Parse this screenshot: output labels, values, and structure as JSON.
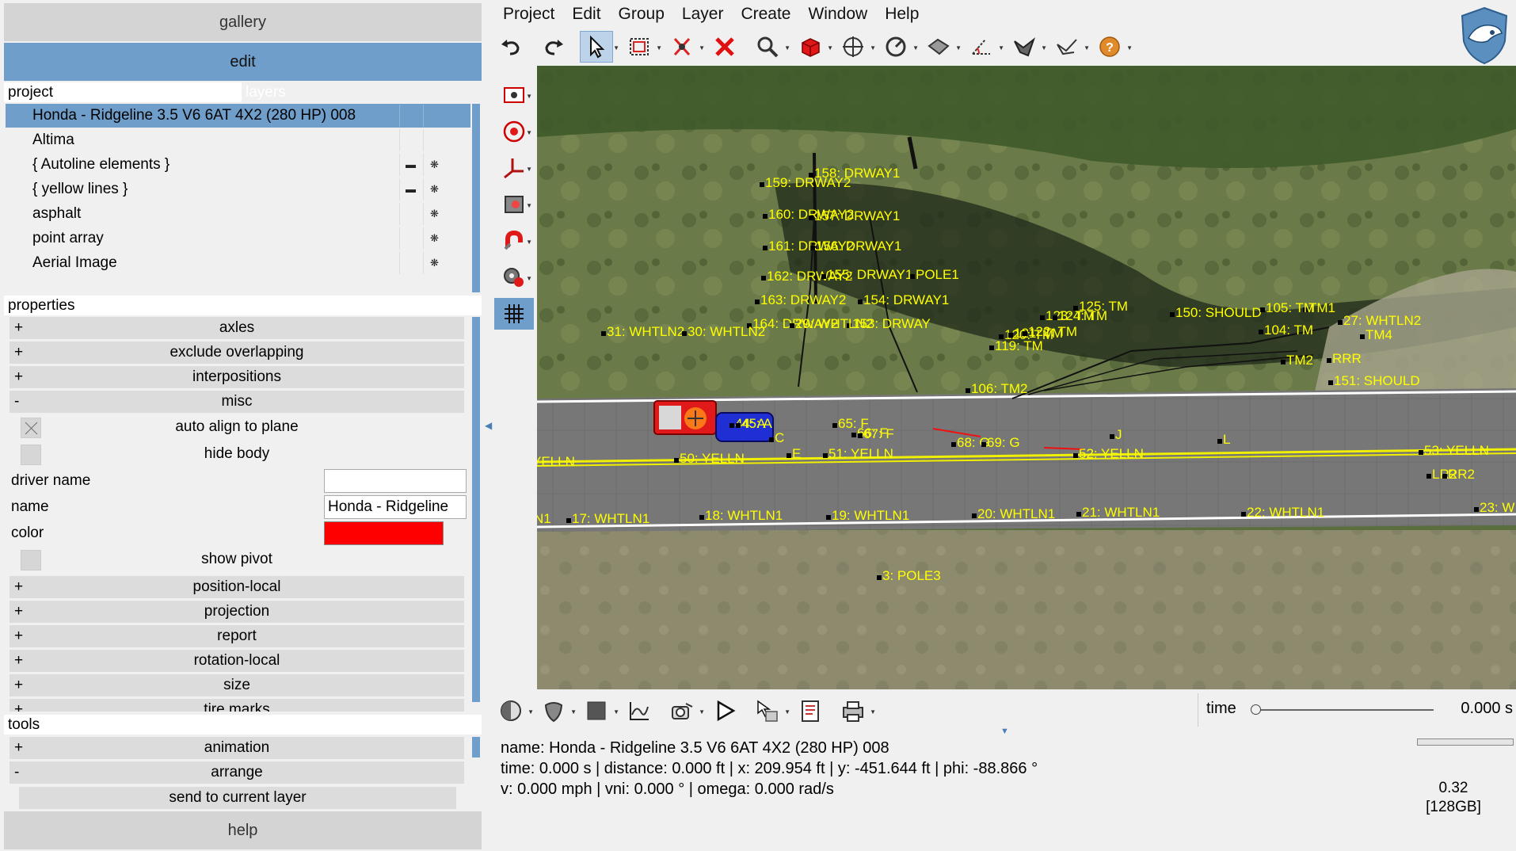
{
  "left_panel": {
    "gallery_label": "gallery",
    "edit_label": "edit",
    "tabs": {
      "project": "project",
      "layers": "layers"
    },
    "layers": [
      {
        "name": "Honda - Ridgeline 3.5 V6 6AT 4X2 (280 HP) 008",
        "selected": true,
        "c1": "",
        "c2": ""
      },
      {
        "name": "Altima",
        "selected": false,
        "c1": "",
        "c2": ""
      },
      {
        "name": "{ Autoline elements }",
        "selected": false,
        "c1": "▬",
        "c2": "❋"
      },
      {
        "name": "{ yellow lines }",
        "selected": false,
        "c1": "▬",
        "c2": "❋"
      },
      {
        "name": "asphalt",
        "selected": false,
        "c1": "",
        "c2": "❋"
      },
      {
        "name": "point array",
        "selected": false,
        "c1": "",
        "c2": "❋"
      },
      {
        "name": "Aerial Image",
        "selected": false,
        "c1": "",
        "c2": "❋"
      }
    ],
    "properties_header": "properties",
    "properties": {
      "axles": {
        "sign": "+",
        "label": "axles"
      },
      "exclude_overlapping": {
        "sign": "+",
        "label": "exclude overlapping"
      },
      "interpositions": {
        "sign": "+",
        "label": "interpositions"
      },
      "misc": {
        "sign": "-",
        "label": "misc"
      },
      "auto_align": "auto align to plane",
      "hide_body": "hide body",
      "driver_name_label": "driver name",
      "driver_name_value": "",
      "name_label": "name",
      "name_value": "Honda - Ridgeline",
      "color_label": "color",
      "color_value": "#ff0000",
      "show_pivot": "show pivot",
      "position_local": {
        "sign": "+",
        "label": "position-local"
      },
      "projection": {
        "sign": "+",
        "label": "projection"
      },
      "report": {
        "sign": "+",
        "label": "report"
      },
      "rotation_local": {
        "sign": "+",
        "label": "rotation-local"
      },
      "size": {
        "sign": "+",
        "label": "size"
      },
      "tire_marks": {
        "sign": "+",
        "label": "tire marks"
      }
    },
    "tools_header": "tools",
    "tools": {
      "animation": {
        "sign": "+",
        "label": "animation"
      },
      "arrange": {
        "sign": "-",
        "label": "arrange"
      },
      "send_label": "send to current layer"
    },
    "help_label": "help"
  },
  "menubar": [
    "Project",
    "Edit",
    "Group",
    "Layer",
    "Create",
    "Window",
    "Help"
  ],
  "toolbar_icons": [
    "undo-icon",
    "redo-icon",
    "select-arrow-icon",
    "box-select-icon",
    "cut-point-icon",
    "delete-icon",
    "zoom-icon",
    "cube-icon",
    "pan-crosshair-icon",
    "measure-dial-icon",
    "plane-icon",
    "angle-measure-icon",
    "terrain-icon",
    "surface-icon",
    "help-icon"
  ],
  "side_tools": [
    "camera-record-icon",
    "target-icon",
    "axis-icon",
    "screenshot-icon",
    "magnet-icon",
    "settings-icon",
    "grid-icon"
  ],
  "viewport_labels": [
    "158: DRWAY1",
    "159: DRWAY2",
    "160: DRWAY2",
    "157: DRWAY1",
    "161: DRWAY2",
    "156: DRWAY1",
    "162: DRWAY2",
    "155: DRWAY1",
    "POLE1",
    "163: DRWAY2",
    "154: DRWAY1",
    "164: DRWAY2",
    "153: DRWAY",
    "31: WHTLN2",
    "30: WHTLN2",
    "29: WHTLN2",
    "150: SHOULD",
    "27: WHTLN2",
    "151: SHOULD",
    "65: F",
    "66: F",
    "67: F",
    "68: G",
    "69: G",
    "51: YELLN",
    "50: YELLN",
    "52: YELLN",
    "53: YELLN",
    "YELLN",
    "17: WHTLN1",
    "18: WHTLN1",
    "19: WHTLN1",
    "20: WHTLN1",
    "21: WHTLN1",
    "22: WHTLN1",
    "23: W",
    "N1",
    "3: POLE3",
    "44: A",
    "45: A",
    "C",
    "E",
    "TM1",
    "TM2",
    "TM4",
    "RRR",
    "LR2",
    "RR2",
    "106: TM2",
    "119: TM",
    "120: TM",
    "121: TM",
    "122: TM",
    "123: TM",
    "124: TM",
    "125: TM",
    "104: TM",
    "105: TM",
    "J",
    "L"
  ],
  "bottom_icons": [
    "shading-icon",
    "material-icon",
    "fill-icon",
    "graph-icon",
    "camera-icon",
    "play-icon",
    "export-icon",
    "report-icon",
    "print-icon"
  ],
  "time": {
    "label": "time",
    "value": "0.000 s"
  },
  "info": {
    "line1": "name: Honda - Ridgeline 3.5 V6 6AT 4X2 (280 HP) 008",
    "line2": "time: 0.000 s | distance: 0.000 ft | x: 209.954 ft | y: -451.644 ft | phi: -88.866 °",
    "line3": "v: 0.000 mph | vni: 0.000 ° | omega: 0.000 rad/s"
  },
  "memory": {
    "ratio": "0.32",
    "total": "[128GB]"
  }
}
